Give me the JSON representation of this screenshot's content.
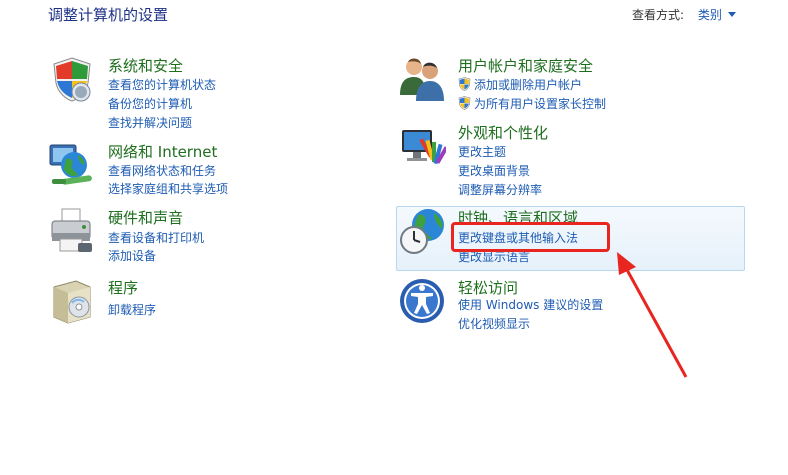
{
  "header": {
    "title": "调整计算机的设置",
    "view_by_label": "查看方式:",
    "view_by_value": "类别"
  },
  "categories": [
    {
      "heading": "系统和安全",
      "links": [
        "查看您的计算机状态",
        "备份您的计算机",
        "查找并解决问题"
      ],
      "icon": "shield-security-icon"
    },
    {
      "heading": "网络和 Internet",
      "links": [
        "查看网络状态和任务",
        "选择家庭组和共享选项"
      ],
      "icon": "network-globe-icon"
    },
    {
      "heading": "硬件和声音",
      "links": [
        "查看设备和打印机",
        "添加设备"
      ],
      "icon": "printer-icon"
    },
    {
      "heading": "程序",
      "links": [
        "卸载程序"
      ],
      "icon": "programs-box-icon"
    },
    {
      "heading": "用户帐户和家庭安全",
      "links": [
        "添加或删除用户帐户",
        "为所有用户设置家长控制"
      ],
      "icon": "users-icon"
    },
    {
      "heading": "外观和个性化",
      "links": [
        "更改主题",
        "更改桌面背景",
        "调整屏幕分辨率"
      ],
      "icon": "monitor-palette-icon"
    },
    {
      "heading": "时钟、语言和区域",
      "links": [
        "更改键盘或其他输入法",
        "更改显示语言"
      ],
      "icon": "clock-globe-icon"
    },
    {
      "heading": "轻松访问",
      "links": [
        "使用 Windows 建议的设置",
        "优化视频显示"
      ],
      "icon": "ease-of-access-icon"
    }
  ],
  "colors": {
    "heading_green": "#1e6e1e",
    "link_blue": "#1e5cb3",
    "highlight_red": "#e8251f",
    "hover_border": "#b9d7ef"
  }
}
